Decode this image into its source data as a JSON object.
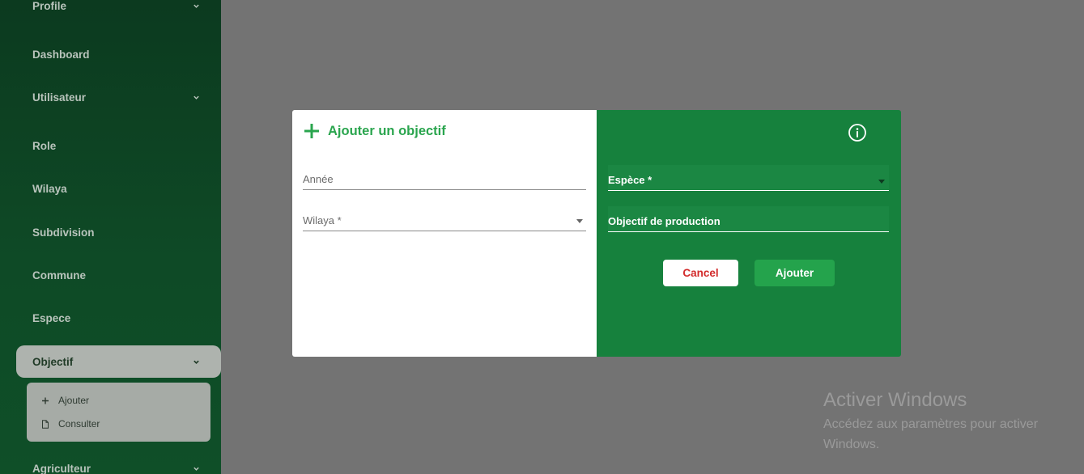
{
  "sidebar": {
    "items": [
      {
        "label": "Profile",
        "has_chevron": true
      },
      {
        "label": "Dashboard",
        "has_chevron": false
      },
      {
        "label": "Utilisateur",
        "has_chevron": true
      },
      {
        "label": "Role",
        "has_chevron": false
      },
      {
        "label": "Wilaya",
        "has_chevron": false
      },
      {
        "label": "Subdivision",
        "has_chevron": false
      },
      {
        "label": "Commune",
        "has_chevron": false
      },
      {
        "label": "Espece",
        "has_chevron": false
      },
      {
        "label": "Objectif",
        "has_chevron": true,
        "active": true
      },
      {
        "label": "Agriculteur",
        "has_chevron": true
      }
    ],
    "submenu": [
      {
        "label": "Ajouter",
        "icon": "plus-icon"
      },
      {
        "label": "Consulter",
        "icon": "document-icon"
      }
    ]
  },
  "modal": {
    "title": "Ajouter un objectif",
    "title_icon": "plus-icon",
    "left_fields": {
      "annee": {
        "label": "Année",
        "value": ""
      },
      "wilaya": {
        "label": "Wilaya *",
        "value": ""
      }
    },
    "right_fields": {
      "espece": {
        "label": "Espèce *",
        "value": ""
      },
      "objectif_production": {
        "label": "Objectif de production",
        "value": ""
      }
    },
    "info_icon": "info-icon",
    "buttons": {
      "cancel": "Cancel",
      "submit": "Ajouter"
    }
  },
  "watermark": {
    "title": "Activer Windows",
    "subtitle": "Accédez aux paramètres pour activer Windows."
  },
  "colors": {
    "sidebar_bg": "#0e4a26",
    "modal_right_bg": "#16813d",
    "accent_green": "#2aa54e",
    "cancel_text": "#d22b2b",
    "submit_bg": "#24a34c",
    "overlay": "#737373"
  }
}
